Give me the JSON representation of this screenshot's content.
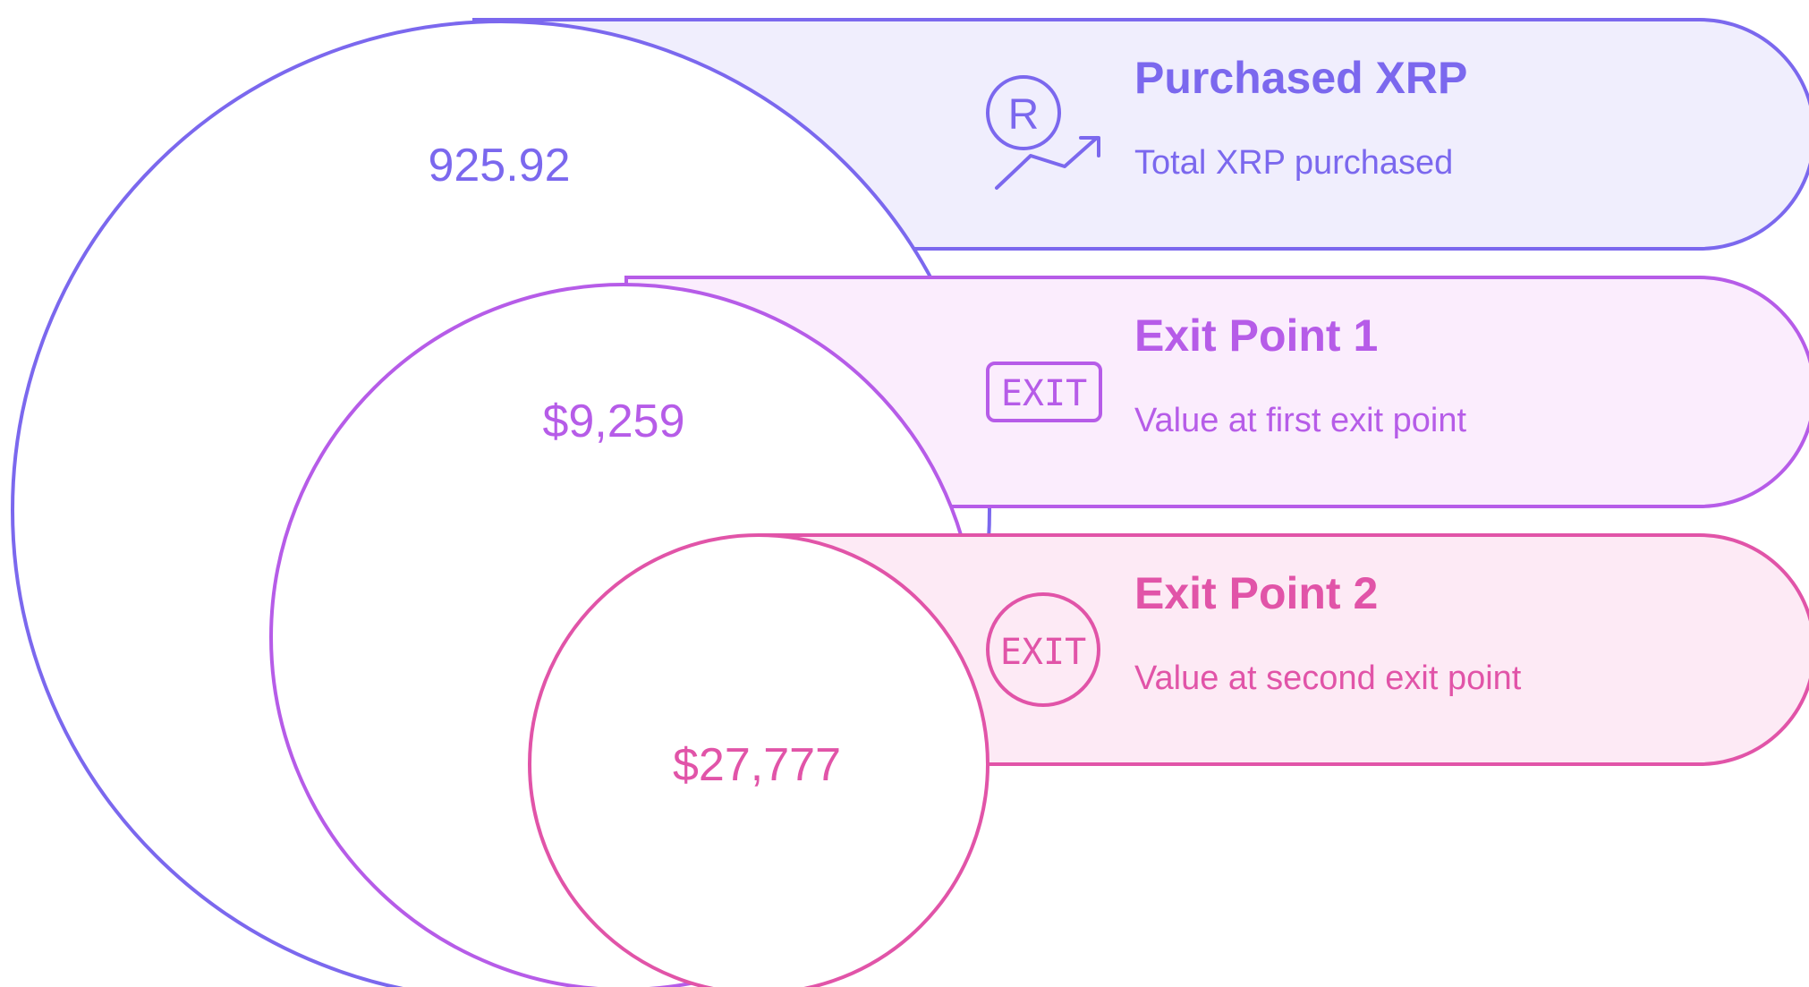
{
  "tiers": [
    {
      "title": "Purchased XRP",
      "description": "Total XRP purchased",
      "value": "925.92",
      "icon": "xrp-growth-icon",
      "icon_text": "R",
      "stroke": "#7B68EE",
      "fill": "#F0EEFD"
    },
    {
      "title": "Exit Point 1",
      "description": "Value at first exit point",
      "value": "$9,259",
      "icon": "exit-sign-icon",
      "icon_text": "EXIT",
      "stroke": "#B65CE8",
      "fill": "#FBEDFD"
    },
    {
      "title": "Exit Point 2",
      "description": "Value at second exit point",
      "value": "$27,777",
      "icon": "exit-circle-icon",
      "icon_text": "EXIT",
      "stroke": "#E154A8",
      "fill": "#FDEAF5"
    }
  ]
}
